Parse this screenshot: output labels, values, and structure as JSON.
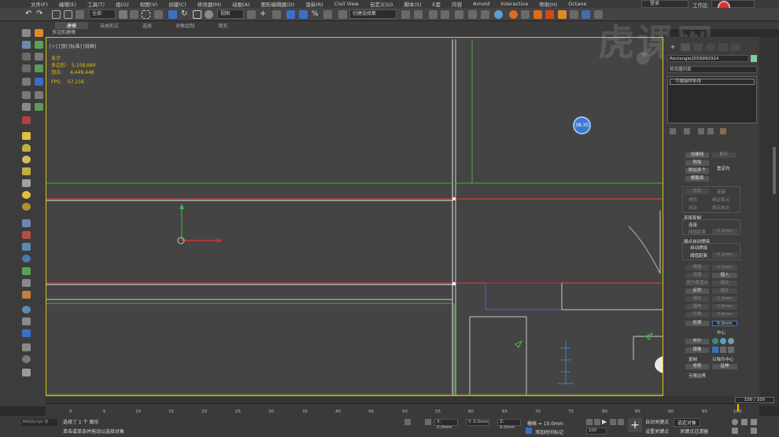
{
  "menu": [
    "文件(F)",
    "编辑(E)",
    "工具(T)",
    "组(G)",
    "视图(V)",
    "创建(C)",
    "修改器(M)",
    "动画(A)",
    "图形编辑器(D)",
    "渲染(R)",
    "Civil View",
    "自定义(U)",
    "脚本(S)",
    "E套",
    "内容",
    "Arnold",
    "Interactive",
    "帮助(H)",
    "Octane"
  ],
  "user": {
    "label": "登录",
    "workspace_label": "工作区:"
  },
  "toolbar": {
    "selection_filter": "全部",
    "view_dropdown": "视图",
    "named_selection": "创建选择集"
  },
  "ribbon": {
    "tabs": [
      "建模",
      "自由形式",
      "选择",
      "对象绘制",
      "填充"
    ],
    "sub": "多边形建模"
  },
  "viewport": {
    "label": "[+] [顶] [标准] [线框]",
    "stats": {
      "total": "总计",
      "polys_label": "多边形:",
      "polys": "5,108,660",
      "verts_label": "顶点:",
      "verts": "4,449,448"
    },
    "fps_label": "FPS:",
    "fps": "57.216",
    "timer": "38:35"
  },
  "watermark": "虎课网",
  "command_panel": {
    "object_name": "Rectangle2059992924",
    "modifier_list": "修改器列表",
    "stack_item": "可编辑样条线",
    "buttons": {
      "create_line": "创建线",
      "break": "断开",
      "attach": "附加",
      "attach_multi": "附加多个",
      "reorient": "重定向",
      "cross_section": "横截面",
      "refine": "优化",
      "connect": "连接",
      "linear": "线性",
      "bind_first": "绑定首点",
      "closed": "闭合",
      "bind_last": "绑定末点",
      "connect_copy": "连接复制",
      "connect2": "连接",
      "threshold": "阈值距离",
      "auto_weld_group": "端点自动焊接",
      "auto_weld": "自动焊接",
      "threshold2": "阈值距离",
      "weld": "焊接",
      "connect3": "连接",
      "insert": "插入",
      "set_first": "设为首顶点",
      "fuse": "熔合",
      "reverse": "反转",
      "cycle": "循环",
      "intersect": "相交",
      "fillet": "圆角",
      "chamfer": "切角",
      "outline": "轮廓",
      "center": "中心",
      "boolean": "布尔",
      "mirror": "镜像",
      "copy": "复制",
      "mirror_about_pivot": "以轴为中心",
      "trim": "修剪",
      "extend": "延伸",
      "infinite_bounds": "无限边界"
    },
    "outline_value": "0.0mm",
    "spin_value": "0.1mm"
  },
  "timeline": {
    "frame": "100 / 100",
    "ticks": [
      "0",
      "5",
      "10",
      "15",
      "20",
      "25",
      "30",
      "35",
      "40",
      "45",
      "50",
      "55",
      "60",
      "65",
      "70",
      "75",
      "80",
      "85",
      "90",
      "95",
      "100"
    ]
  },
  "status": {
    "maxscript": "MAXScript 侦",
    "selected": "选择了 1 个 图形",
    "hint": "单击或单击并拖动以选择对象",
    "x": "X: 0.0mm",
    "y": "Y: 0.0mm",
    "z": "Z: 0.0mm",
    "grid": "栅格 = 10.0mm",
    "add_time_tag": "添加时间标记",
    "auto_key": "自动关键点",
    "selected_obj": "选定对象",
    "set_key": "设置关键点",
    "key_filter": "关键点过滤器",
    "frame_field": "100"
  }
}
